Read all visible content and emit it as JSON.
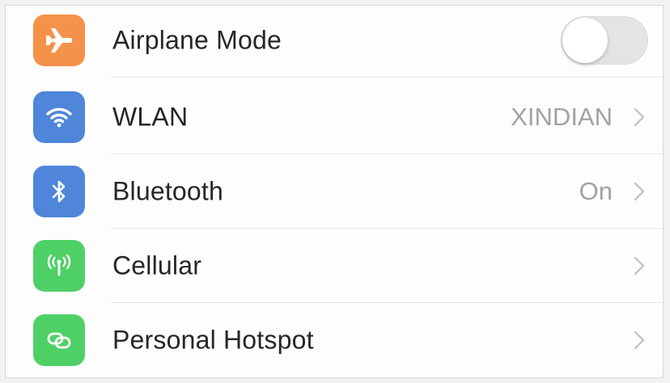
{
  "settings": {
    "rows": [
      {
        "label": "Airplane Mode",
        "icon": "airplane-icon",
        "icon_color": "#f5924a",
        "control": "toggle",
        "toggle_on": false
      },
      {
        "label": "WLAN",
        "icon": "wifi-icon",
        "icon_color": "#4f86d9",
        "detail": "XINDIAN",
        "control": "chevron"
      },
      {
        "label": "Bluetooth",
        "icon": "bluetooth-icon",
        "icon_color": "#4f86d9",
        "detail": "On",
        "control": "chevron"
      },
      {
        "label": "Cellular",
        "icon": "cellular-antenna-icon",
        "icon_color": "#4fd066",
        "control": "chevron"
      },
      {
        "label": "Personal Hotspot",
        "icon": "hotspot-link-icon",
        "icon_color": "#4fd066",
        "control": "chevron"
      }
    ]
  }
}
